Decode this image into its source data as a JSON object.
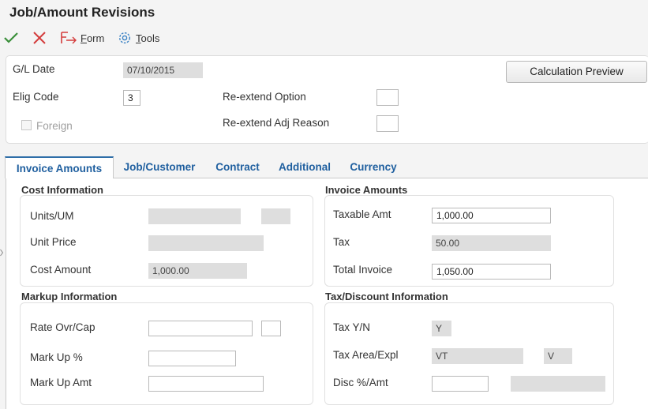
{
  "window": {
    "title": "Job/Amount Revisions"
  },
  "toolbar": {
    "form_label": "Form",
    "form_key": "F",
    "tools_label": "Tools",
    "tools_key": "T"
  },
  "header": {
    "gl_date_label": "G/L Date",
    "gl_date_value": "07/10/2015",
    "elig_code_label": "Elig Code",
    "elig_code_value": "3",
    "foreign_label": "Foreign",
    "reextend_option_label": "Re-extend Option",
    "reextend_option_value": "",
    "reextend_adj_reason_label": "Re-extend Adj Reason",
    "reextend_adj_reason_value": "",
    "calc_preview_label": "Calculation Preview"
  },
  "tabs": [
    {
      "label": "Invoice Amounts"
    },
    {
      "label": "Job/Customer"
    },
    {
      "label": "Contract"
    },
    {
      "label": "Additional"
    },
    {
      "label": "Currency"
    }
  ],
  "cost_info": {
    "title": "Cost Information",
    "units_um_label": "Units/UM",
    "units_value": "",
    "um_value": "",
    "unit_price_label": "Unit Price",
    "unit_price_value": "",
    "cost_amount_label": "Cost Amount",
    "cost_amount_value": "1,000.00"
  },
  "invoice_amounts": {
    "title": "Invoice Amounts",
    "taxable_amt_label": "Taxable Amt",
    "taxable_amt_value": "1,000.00",
    "tax_label": "Tax",
    "tax_value": "50.00",
    "total_invoice_label": "Total Invoice",
    "total_invoice_value": "1,050.00"
  },
  "markup_info": {
    "title": "Markup Information",
    "rate_ovr_cap_label": "Rate Ovr/Cap",
    "rate_value": "",
    "cap_value": "",
    "mark_up_pct_label": "Mark Up %",
    "mark_up_pct_value": "",
    "mark_up_amt_label": "Mark Up Amt",
    "mark_up_amt_value": ""
  },
  "tax_discount_info": {
    "title": "Tax/Discount Information",
    "tax_yn_label": "Tax Y/N",
    "tax_yn_value": "Y",
    "tax_area_label": "Tax Area/Expl",
    "tax_area_value": "VT",
    "tax_expl_value": "V",
    "disc_label": "Disc %/Amt",
    "disc_pct_value": "",
    "disc_amt_value": ""
  },
  "colors": {
    "accent": "#1f5f9f",
    "ok": "#3a8f3a",
    "cancel": "#d43c3c",
    "readonly_bg": "#dedede"
  },
  "icons": {
    "ok": "checkmark-icon",
    "cancel": "close-icon",
    "form": "form-icon",
    "tools": "gear-icon"
  }
}
